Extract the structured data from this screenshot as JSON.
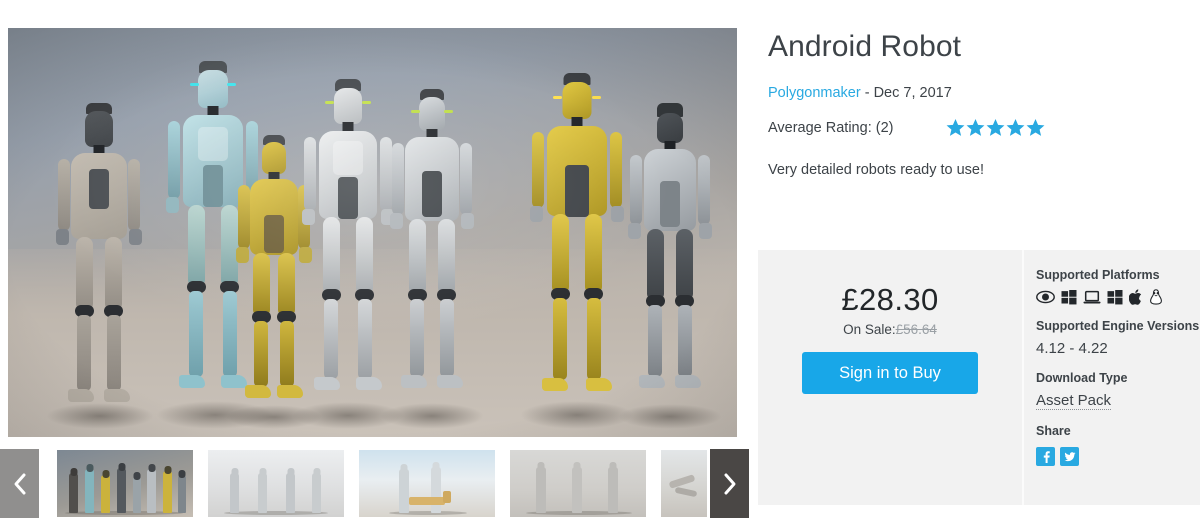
{
  "product": {
    "title": "Android Robot",
    "author": "Polygonmaker",
    "separator": " - ",
    "date": "Dec 7, 2017",
    "rating_label": "Average Rating: (2)",
    "rating_stars": 5,
    "description": "Very detailed robots ready to use!"
  },
  "pricing": {
    "price": "£28.30",
    "sale_prefix": "On Sale:",
    "original_price": "£56.64",
    "buy_label": "Sign in to Buy"
  },
  "meta": {
    "platforms_heading": "Supported Platforms",
    "platforms": [
      "vr-eye-icon",
      "windows-icon",
      "desktop-icon",
      "windows-icon",
      "apple-icon",
      "linux-icon"
    ],
    "engine_heading": "Supported Engine Versions",
    "engine_versions": "4.12 - 4.22",
    "download_heading": "Download Type",
    "download_type": "Asset Pack",
    "share_heading": "Share",
    "share": [
      "facebook-icon",
      "twitter-icon"
    ]
  },
  "gallery": {
    "prev_label": "‹",
    "next_label": "›",
    "active_index": 0,
    "thumbnails": [
      {
        "name": "robot-lineup-color",
        "style": "thumb-a"
      },
      {
        "name": "robot-lineup-white-tpose",
        "style": "thumb-b"
      },
      {
        "name": "robot-pair-scene",
        "style": "thumb-c"
      },
      {
        "name": "robot-trio-grey",
        "style": "thumb-d"
      },
      {
        "name": "robot-detail-partial",
        "style": "thumb-e"
      }
    ]
  },
  "colors": {
    "accent": "#29a9e1",
    "button": "#18a7e8",
    "panel_bg": "#f2f2f2",
    "text": "#3d4348",
    "nav_prev": "#908f8e",
    "nav_next": "#4a4745"
  }
}
